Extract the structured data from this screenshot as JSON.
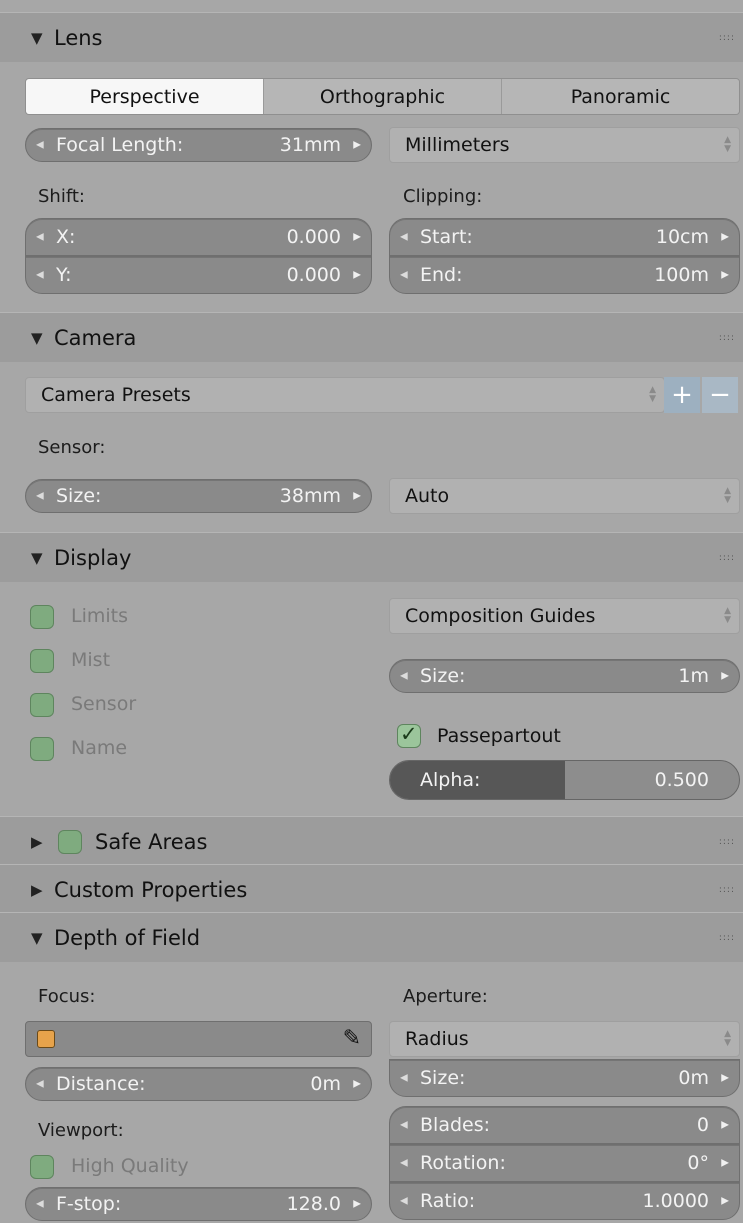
{
  "lens": {
    "header": "Lens",
    "tabs": [
      "Perspective",
      "Orthographic",
      "Panoramic"
    ],
    "active_tab": "Perspective",
    "focal_length": {
      "label": "Focal Length:",
      "value": "31mm"
    },
    "lens_unit": "Millimeters",
    "shift_label": "Shift:",
    "shift_x": {
      "label": "X:",
      "value": "0.000"
    },
    "shift_y": {
      "label": "Y:",
      "value": "0.000"
    },
    "clipping_label": "Clipping:",
    "clip_start": {
      "label": "Start:",
      "value": "10cm"
    },
    "clip_end": {
      "label": "End:",
      "value": "100m"
    }
  },
  "camera": {
    "header": "Camera",
    "presets": "Camera Presets",
    "sensor_label": "Sensor:",
    "size": {
      "label": "Size:",
      "value": "38mm"
    },
    "sensor_fit": "Auto"
  },
  "display": {
    "header": "Display",
    "checks": [
      {
        "label": "Limits",
        "checked": false
      },
      {
        "label": "Mist",
        "checked": false
      },
      {
        "label": "Sensor",
        "checked": false
      },
      {
        "label": "Name",
        "checked": false
      }
    ],
    "guides": "Composition Guides",
    "size": {
      "label": "Size:",
      "value": "1m"
    },
    "passepartout": {
      "label": "Passepartout",
      "checked": true
    },
    "alpha": {
      "label": "Alpha:",
      "value": "0.500",
      "fraction": 0.5
    }
  },
  "safe_areas": {
    "header": "Safe Areas",
    "checked": false
  },
  "custom_properties": {
    "header": "Custom Properties"
  },
  "dof": {
    "header": "Depth of Field",
    "focus_label": "Focus:",
    "distance": {
      "label": "Distance:",
      "value": "0m"
    },
    "viewport_label": "Viewport:",
    "high_quality": {
      "label": "High Quality",
      "checked": false
    },
    "fstop": {
      "label": "F-stop:",
      "value": "128.0"
    },
    "aperture_label": "Aperture:",
    "aperture_type": "Radius",
    "size": {
      "label": "Size:",
      "value": "0m"
    },
    "blades": {
      "label": "Blades:",
      "value": "0"
    },
    "rotation": {
      "label": "Rotation:",
      "value": "0°"
    },
    "ratio": {
      "label": "Ratio:",
      "value": "1.0000"
    }
  },
  "icons": {
    "expanded": "▼",
    "collapsed": "▶",
    "grip": "::::",
    "left_arrow": "◀",
    "right_arrow": "▶",
    "updown": "▲▼",
    "plus": "+",
    "minus": "−"
  },
  "colors": {
    "background": "#a7a7a7",
    "number_field": "#8a8a8a",
    "checkbox": "#7fab7f"
  }
}
